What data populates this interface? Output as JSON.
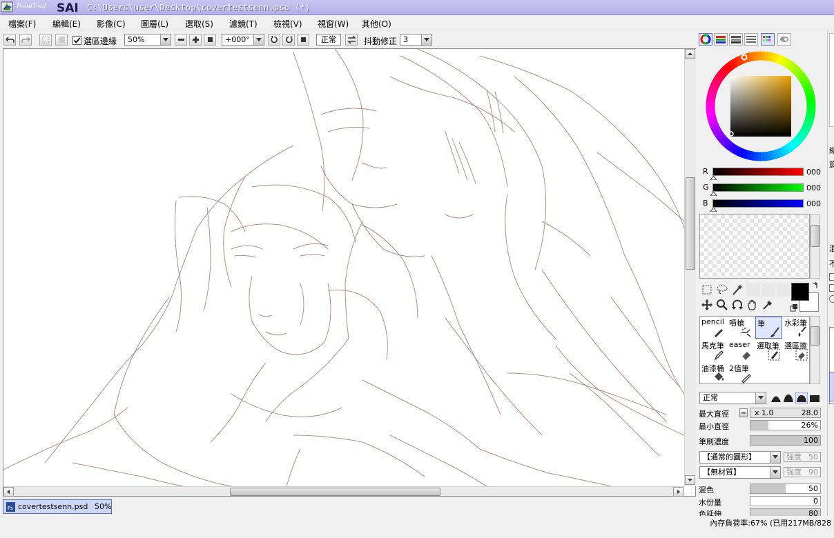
{
  "window": {
    "logo_text": "PaintTool SAI",
    "title": "C:\\Users\\user\\Desktop\\covertestsenn.psd (*)"
  },
  "menu": [
    {
      "label": "檔案(F)"
    },
    {
      "label": "編輯(E)"
    },
    {
      "label": "影像(C)"
    },
    {
      "label": "圖層(L)"
    },
    {
      "label": "選取(S)"
    },
    {
      "label": "濾鏡(T)"
    },
    {
      "label": "檢視(V)"
    },
    {
      "label": "視窗(W)"
    },
    {
      "label": "其他(O)"
    }
  ],
  "toolbar": {
    "selection_edge_label": "選區邊緣",
    "selection_edge_checked": true,
    "zoom": "50%",
    "rotation": "+000°",
    "blend_mode": "正常",
    "stabilizer_label": "抖動修正",
    "stabilizer_value": "3"
  },
  "colors": {
    "r_label": "R",
    "r_value": "000",
    "g_label": "G",
    "g_value": "000",
    "b_label": "B",
    "b_value": "000",
    "foreground": "#000000",
    "background": "#ffffff",
    "sketch_line": "#a07a78",
    "accent_selected": "#5a6bc8"
  },
  "tools_grid": [
    {
      "label": "pencil",
      "icon": "pencil-icon",
      "selected": false
    },
    {
      "label": "噴槍",
      "icon": "airbrush-icon",
      "selected": false
    },
    {
      "label": "筆",
      "icon": "brush-icon",
      "selected": true
    },
    {
      "label": "水彩筆",
      "icon": "watercolor-icon",
      "selected": false
    },
    {
      "label": "馬克筆",
      "icon": "marker-icon",
      "selected": false
    },
    {
      "label": "easer",
      "icon": "eraser-icon",
      "selected": false
    },
    {
      "label": "選取筆",
      "icon": "select-pen-icon",
      "selected": false
    },
    {
      "label": "選區擦",
      "icon": "select-eraser-icon",
      "selected": false
    },
    {
      "label": "油漆桶",
      "icon": "bucket-icon",
      "selected": false
    },
    {
      "label": "2值筆",
      "icon": "binary-pen-icon",
      "selected": false
    }
  ],
  "brush": {
    "blend_mode": "正常",
    "max_size_label": "最大直徑",
    "size_multiplier": "x 1.0",
    "max_size_value": "28.0",
    "min_size_label": "最小直徑",
    "min_size_value": "26%",
    "min_size_fraction": 0.26,
    "density_label": "筆刷濃度",
    "density_value": "100",
    "density_fraction": 1.0,
    "shape": "【通常的圓形】",
    "shape_strength_label": "強度",
    "shape_strength_value": "50",
    "texture": "【無材質】",
    "texture_strength_label": "強度",
    "texture_strength_value": "90",
    "blending_label": "混色",
    "blending_value": "50",
    "blending_fraction": 0.5,
    "dilution_label": "水份量",
    "dilution_value": "0",
    "persistence_label": "色延伸",
    "persistence_value": "80"
  },
  "document_tab": {
    "name": "covertestsenn.psd",
    "zoom": "50%"
  },
  "status": {
    "memory": "內存負荷率:67% (已用217MB/828"
  },
  "far_panel_chars": [
    "縮",
    "旋",
    "混",
    "不"
  ]
}
